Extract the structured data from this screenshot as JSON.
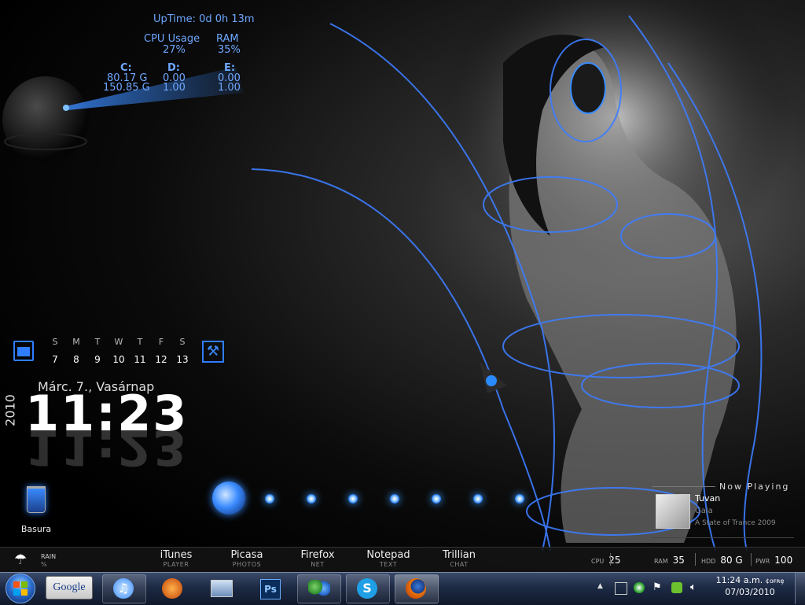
{
  "system_monitor": {
    "uptime": "UpTime: 0d 0h 13m",
    "cpu_label": "CPU Usage",
    "cpu_value": "27%",
    "ram_label": "RAM",
    "ram_value": "35%",
    "drives": [
      {
        "label": "C:",
        "used": "80.17 G",
        "total": "150.85 G"
      },
      {
        "label": "D:",
        "used": "0.00",
        "total": "1.00"
      },
      {
        "label": "E:",
        "used": "0.00",
        "total": "1.00"
      }
    ]
  },
  "calendar": {
    "weekdays": [
      "S",
      "M",
      "T",
      "W",
      "T",
      "F",
      "S"
    ],
    "dates": [
      "7",
      "8",
      "9",
      "10",
      "11",
      "12",
      "13"
    ]
  },
  "clock": {
    "date_text": "Márc. 7., Vasárnap",
    "year": "2010",
    "time": "11:23"
  },
  "recycle_bin": {
    "label": "Basura"
  },
  "now_playing": {
    "header": "Now Playing",
    "artist": "Tuvan",
    "title": "Gaia",
    "album": "A State of Trance 2009"
  },
  "weather": {
    "label": "RAIN",
    "unit": "%"
  },
  "launchers": [
    {
      "name": "iTunes",
      "sub": "PLAYER"
    },
    {
      "name": "Picasa",
      "sub": "PHOTOS"
    },
    {
      "name": "Firefox",
      "sub": "NET"
    },
    {
      "name": "Notepad",
      "sub": "TEXT"
    },
    {
      "name": "Trillian",
      "sub": "CHAT"
    }
  ],
  "stats": {
    "cpu_label": "CPU",
    "cpu_value": "25",
    "ram_label": "RAM",
    "ram_value": "35",
    "hdd_label": "HDD",
    "hdd_value": "80 G",
    "pwr_label": "PWR",
    "pwr_value": "100"
  },
  "taskbar": {
    "google_label": "Google",
    "pinned_icons": [
      "itunes-icon",
      "vlc-icon",
      "network-icon",
      "photoshop-icon",
      "messenger-icon",
      "skype-icon",
      "firefox-icon"
    ]
  },
  "tray": {
    "time": "11:24 a.m.",
    "date": "07/03/2010",
    "ime": "¢ᴏꜰʀȩ"
  },
  "colors": {
    "accent": "#3a8bff",
    "taskbar": "#1d2a44"
  }
}
